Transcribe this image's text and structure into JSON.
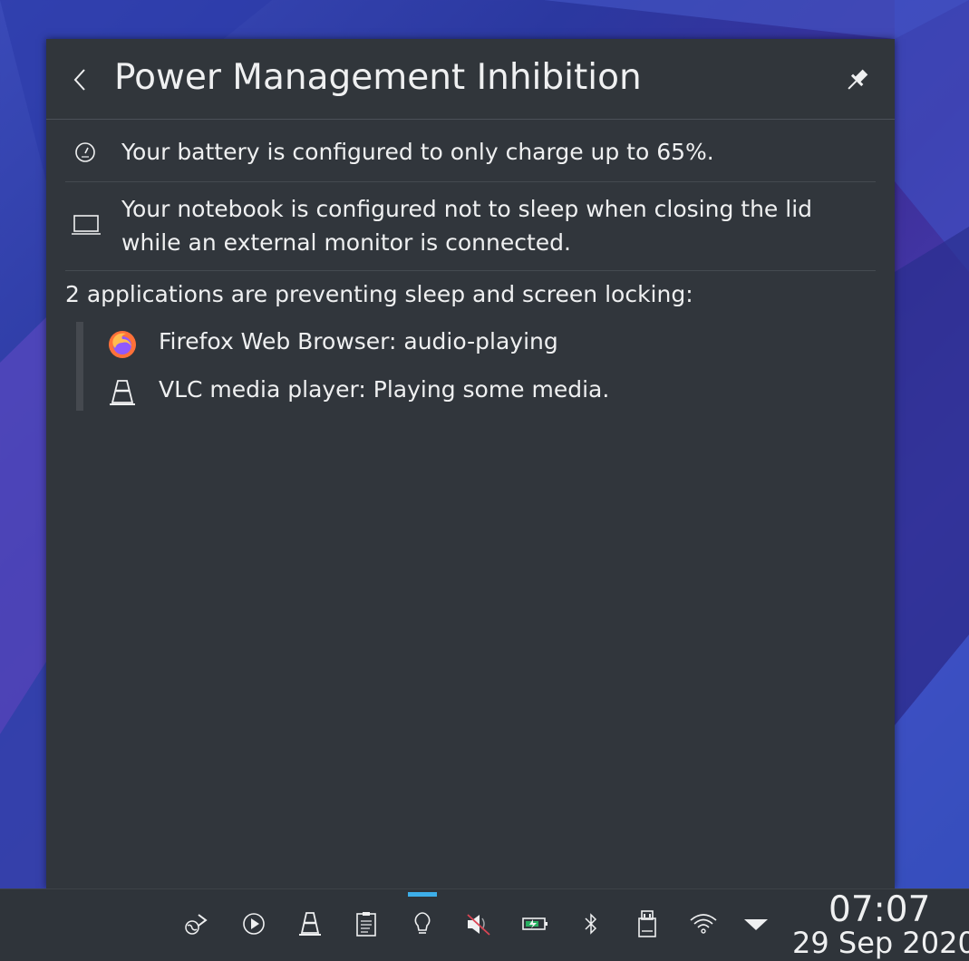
{
  "popup": {
    "title": "Power Management Inhibition",
    "back_icon": "chevron-left-icon",
    "pin_icon": "pin-icon"
  },
  "notices": [
    {
      "icon": "gauge-icon",
      "text": "Your battery is configured to only charge up to 65%."
    },
    {
      "icon": "laptop-icon",
      "text": "Your notebook is configured not to sleep when closing the lid while an external monitor is connected."
    }
  ],
  "apps_heading": "2 applications are preventing sleep and screen locking:",
  "apps": [
    {
      "icon": "firefox-icon",
      "label": "Firefox Web Browser: audio-playing"
    },
    {
      "icon": "vlc-cone-icon",
      "label": "VLC media player: Playing some media."
    }
  ],
  "taskbar": {
    "tray_icons": [
      "kde-connect-icon",
      "media-player-icon",
      "vlc-cone-icon",
      "clipboard-icon",
      "lightbulb-icon",
      "volume-muted-icon",
      "battery-icon",
      "bluetooth-icon",
      "removable-device-icon",
      "wifi-icon",
      "expand-arrow-icon"
    ],
    "active_icon": "lightbulb-icon",
    "accent_color": "#3daee9",
    "clock_time": "07:07",
    "clock_date": "29 Sep 2020"
  }
}
